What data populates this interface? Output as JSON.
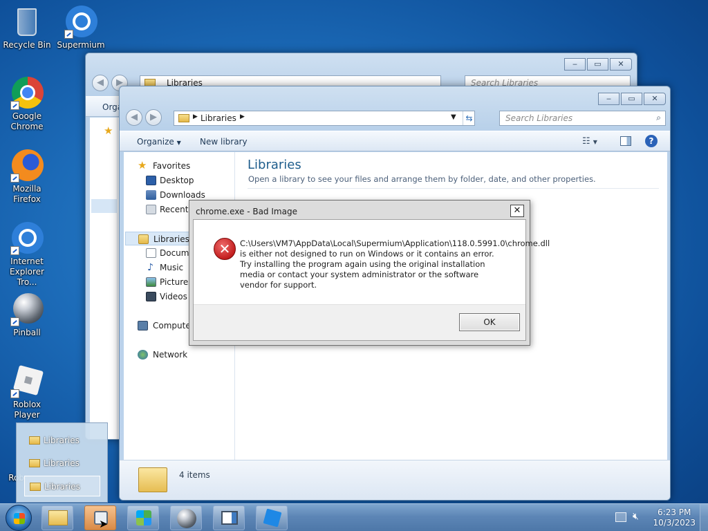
{
  "desktop": {
    "icons": [
      {
        "label": "Recycle Bin"
      },
      {
        "label": "Supermium"
      },
      {
        "label": "Google Chrome"
      },
      {
        "label": "Mozilla Firefox"
      },
      {
        "label": "Internet Explorer Tro..."
      },
      {
        "label": "Pinball"
      },
      {
        "label": "Roblox Player"
      },
      {
        "label": "Rob"
      }
    ]
  },
  "back_window": {
    "address": "Libraries",
    "search_placeholder": "Search Libraries",
    "organize_partial": "Orga"
  },
  "front_window": {
    "address": "Libraries",
    "search_placeholder": "Search Libraries",
    "toolbar": {
      "organize": "Organize",
      "new_library": "New library"
    },
    "nav": {
      "favorites": "Favorites",
      "desktop": "Desktop",
      "downloads": "Downloads",
      "recent": "Recent",
      "libraries": "Libraries",
      "documents": "Docum",
      "music": "Music",
      "pictures": "Pictures",
      "videos": "Videos",
      "computer": "Compute",
      "network": "Network"
    },
    "content": {
      "title": "Libraries",
      "subtitle": "Open a library to see your files and arrange them by folder, date, and other properties."
    },
    "details": {
      "count": "4 items"
    }
  },
  "dialog": {
    "title": "chrome.exe - Bad Image",
    "close": "✕",
    "message": "C:\\Users\\VM7\\AppData\\Local\\Supermium\\Application\\118.0.5991.0\\chrome.dll is either not designed to run on Windows or it contains an error. Try installing the program again using the original installation media or contact your system administrator or the software vendor for support.",
    "ok": "OK"
  },
  "jumplist": {
    "items": [
      {
        "label": "Libraries"
      },
      {
        "label": "Libraries"
      },
      {
        "label": "Libraries"
      }
    ]
  },
  "taskbar": {
    "time": "6:23 PM",
    "date": "10/3/2023"
  }
}
